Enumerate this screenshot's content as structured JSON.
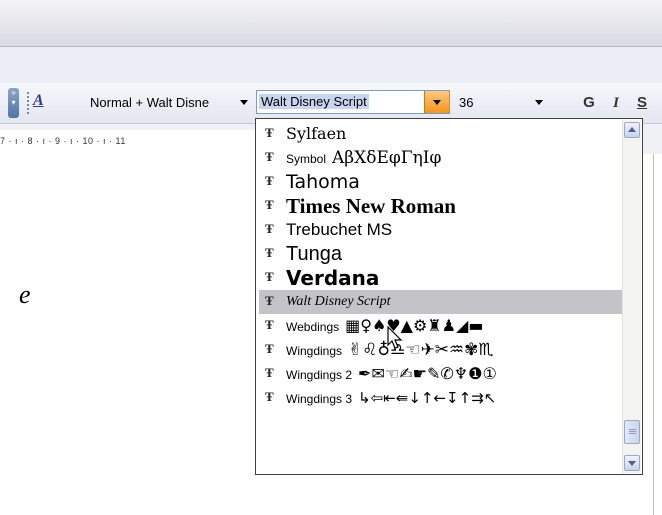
{
  "toolbar": {
    "style_value": "Normal + Walt Disne",
    "font_value": "Walt Disney Script",
    "size_value": "36",
    "bold_label": "G",
    "italic_label": "I",
    "underline_label": "S"
  },
  "ruler": {
    "text": "7 · ı · 8 · ı · 9 · ı · 10 · ı · 11"
  },
  "document": {
    "visible_char": "e"
  },
  "font_list": [
    {
      "name": "Sylfaen",
      "sample": ""
    },
    {
      "name": "Symbol",
      "sample": "ΑβΧδΕφΓηΙφ"
    },
    {
      "name": "Tahoma",
      "sample": ""
    },
    {
      "name": "Times New Roman",
      "sample": ""
    },
    {
      "name": "Trebuchet MS",
      "sample": ""
    },
    {
      "name": "Tunga",
      "sample": ""
    },
    {
      "name": "Verdana",
      "sample": ""
    },
    {
      "name": "Walt Disney Script",
      "sample": ""
    },
    {
      "name": "Webdings",
      "sample": "▦♀♠♥▲⚙♜♟◢▬"
    },
    {
      "name": "Wingdings",
      "sample": "✌♌♁♎☜✈✂♒✾♏"
    },
    {
      "name": "Wingdings 2",
      "sample": "✒✉☜✍☛✎✆♆❶①"
    },
    {
      "name": "Wingdings 3",
      "sample": "↳⇦⇤⇚↓↑←↧↑⇉↖"
    }
  ],
  "selected_font": "Walt Disney Script",
  "colors": {
    "accent": "#f2951f",
    "selection": "#c3c3c8"
  }
}
